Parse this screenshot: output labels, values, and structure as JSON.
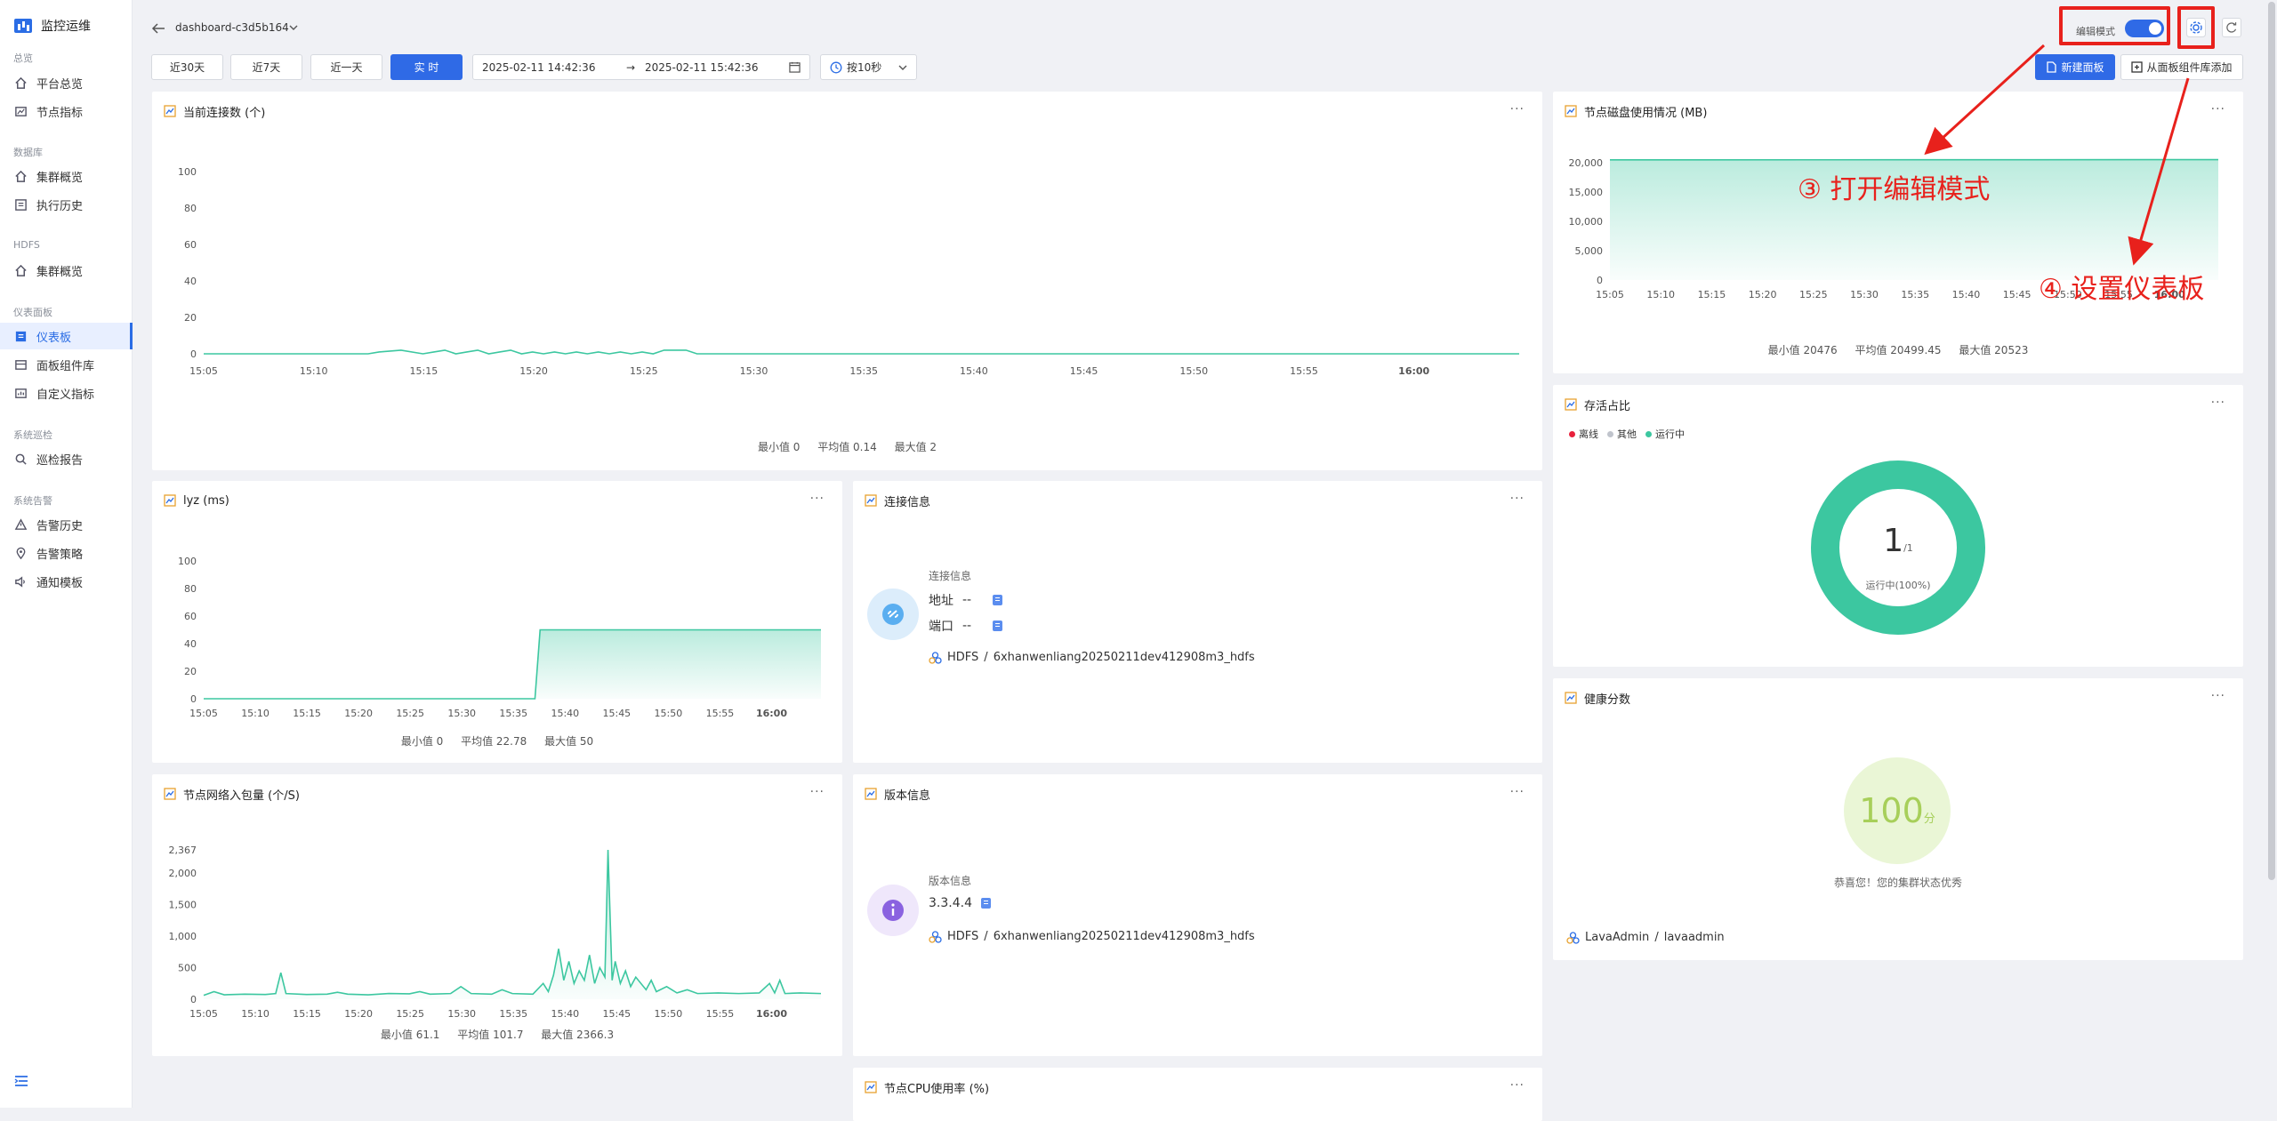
{
  "sidebar": {
    "brand": "监控运维",
    "sections": [
      {
        "title": "总览",
        "items": [
          {
            "label": "平台总览"
          },
          {
            "label": "节点指标"
          }
        ]
      },
      {
        "title": "数据库",
        "items": [
          {
            "label": "集群概览"
          },
          {
            "label": "执行历史"
          }
        ]
      },
      {
        "title": "HDFS",
        "items": [
          {
            "label": "集群概览"
          }
        ]
      },
      {
        "title": "仪表面板",
        "items": [
          {
            "label": "仪表板"
          },
          {
            "label": "面板组件库"
          },
          {
            "label": "自定义指标"
          }
        ]
      },
      {
        "title": "系统巡检",
        "items": [
          {
            "label": "巡检报告"
          }
        ]
      },
      {
        "title": "系统告警",
        "items": [
          {
            "label": "告警历史"
          },
          {
            "label": "告警策略"
          },
          {
            "label": "通知模板"
          }
        ]
      }
    ],
    "active": "仪表板"
  },
  "header": {
    "dashboard_name": "dashboard-c3d5b164",
    "quick_ranges": [
      "近30天",
      "近7天",
      "近一天",
      "实 时"
    ],
    "active_range": "实 时",
    "range_start": "2025-02-11 14:42:36",
    "range_arrow": "→",
    "range_end": "2025-02-11 15:42:36",
    "refresh": "按10秒",
    "edit_mode_label": "编辑模式",
    "edit_mode_on": true,
    "new_panel": "新建面板",
    "add_from_library": "从面板组件库添加"
  },
  "annotations": {
    "open_edit": "③ 打开编辑模式",
    "set_dashboard": "④ 设置仪表板"
  },
  "panels": {
    "connections": {
      "title": "当前连接数 (个)",
      "stats": {
        "min": "最小值 0",
        "avg": "平均值 0.14",
        "max": "最大值 2"
      }
    },
    "disk": {
      "title": "节点磁盘使用情况 (MB)",
      "stats": {
        "min": "最小值 20476",
        "avg": "平均值 20499.45",
        "max": "最大值 20523"
      }
    },
    "lyz": {
      "title": "lyz (ms)",
      "stats": {
        "min": "最小值 0",
        "avg": "平均值 22.78",
        "max": "最大值 50"
      }
    },
    "conn_info": {
      "title": "连接信息",
      "section_label": "连接信息",
      "address_label": "地址",
      "address_value": "--",
      "port_label": "端口",
      "port_value": "--",
      "crumb_root": "HDFS",
      "crumb_sep": "/",
      "crumb_leaf": "6xhanwenliang20250211dev412908m3_hdfs"
    },
    "alive": {
      "title": "存活占比",
      "legend": [
        {
          "label": "离线",
          "color": "#e8213c"
        },
        {
          "label": "其他",
          "color": "#c0c4cc"
        },
        {
          "label": "运行中",
          "color": "#3cc7a0"
        }
      ],
      "center_value": "1",
      "center_total": "/1",
      "center_caption": "运行中(100%)",
      "running_fraction": 1.0
    },
    "net": {
      "title": "节点网络入包量 (个/S)",
      "stats": {
        "min": "最小值 61.1",
        "avg": "平均值 101.7",
        "max": "最大值 2366.3"
      }
    },
    "version": {
      "title": "版本信息",
      "section_label": "版本信息",
      "version_value": "3.3.4.4",
      "crumb_root": "HDFS",
      "crumb_sep": "/",
      "crumb_leaf": "6xhanwenliang20250211dev412908m3_hdfs"
    },
    "health": {
      "title": "健康分数",
      "score": "100",
      "unit": "分",
      "caption": "恭喜您！您的集群状态优秀",
      "user_root": "LavaAdmin",
      "user_sep": "/",
      "user_leaf": "lavaadmin"
    },
    "cpu": {
      "title": "节点CPU使用率 (%)"
    }
  },
  "colors": {
    "accent": "#2f6ae6",
    "series": "#3cc7a0",
    "annotation": "#e8211c"
  },
  "chart_data": [
    {
      "type": "line",
      "title": "当前连接数 (个)",
      "x": [
        "15:05",
        "15:10",
        "15:15",
        "15:20",
        "15:25",
        "15:30",
        "15:35",
        "15:40",
        "15:45",
        "15:50",
        "15:55",
        "16:00"
      ],
      "x_bold": "16:00",
      "ylim": [
        0,
        100
      ],
      "yticks": [
        0,
        20,
        40,
        60,
        80,
        100
      ],
      "xrange": [
        0,
        60
      ],
      "points": [
        [
          0,
          0
        ],
        [
          7.5,
          0
        ],
        [
          8,
          1
        ],
        [
          9,
          2
        ],
        [
          10,
          0
        ],
        [
          10.5,
          1
        ],
        [
          11,
          2
        ],
        [
          11.5,
          0
        ],
        [
          12,
          1
        ],
        [
          12.5,
          2
        ],
        [
          13,
          0
        ],
        [
          13.5,
          1
        ],
        [
          14,
          2
        ],
        [
          14.5,
          0
        ],
        [
          15,
          1
        ],
        [
          15.5,
          0
        ],
        [
          16,
          1
        ],
        [
          16.5,
          0
        ],
        [
          17,
          1
        ],
        [
          17.5,
          0
        ],
        [
          18,
          1
        ],
        [
          18.5,
          0
        ],
        [
          19,
          1
        ],
        [
          19.5,
          0
        ],
        [
          20,
          1
        ],
        [
          20.5,
          0
        ],
        [
          21,
          2
        ],
        [
          22,
          2
        ],
        [
          22.5,
          0
        ],
        [
          60,
          0
        ]
      ]
    },
    {
      "type": "area",
      "title": "节点磁盘使用情况 (MB)",
      "x": [
        "15:05",
        "15:10",
        "15:15",
        "15:20",
        "15:25",
        "15:30",
        "15:35",
        "15:40",
        "15:45",
        "15:50",
        "15:55",
        "16:00"
      ],
      "x_bold": "16:00",
      "ylim": [
        0,
        20000
      ],
      "yticks": [
        0,
        5000,
        10000,
        15000,
        20000
      ],
      "ytick_labels": [
        "0",
        "5,000",
        "10,000",
        "15,000",
        "20,000"
      ],
      "xrange": [
        0,
        60
      ],
      "points": [
        [
          0,
          20476
        ],
        [
          30,
          20499
        ],
        [
          60,
          20523
        ]
      ]
    },
    {
      "type": "area",
      "title": "lyz (ms)",
      "x": [
        "15:05",
        "15:10",
        "15:15",
        "15:20",
        "15:25",
        "15:30",
        "15:35",
        "15:40",
        "15:45",
        "15:50",
        "15:55",
        "16:00"
      ],
      "x_bold": "16:00",
      "ylim": [
        0,
        100
      ],
      "yticks": [
        0,
        20,
        40,
        60,
        80,
        100
      ],
      "xrange": [
        0,
        60
      ],
      "points": [
        [
          0,
          0
        ],
        [
          32.2,
          0
        ],
        [
          32.7,
          50
        ],
        [
          60,
          50
        ]
      ]
    },
    {
      "type": "area",
      "title": "节点网络入包量 (个/S)",
      "x": [
        "15:05",
        "15:10",
        "15:15",
        "15:20",
        "15:25",
        "15:30",
        "15:35",
        "15:40",
        "15:45",
        "15:50",
        "15:55",
        "16:00"
      ],
      "x_bold": "16:00",
      "ylim": [
        0,
        2367
      ],
      "yticks": [
        0,
        500,
        1000,
        1500,
        2000,
        2367
      ],
      "ytick_labels": [
        "0",
        "500",
        "1,000",
        "1,500",
        "2,000",
        "2,367"
      ],
      "xrange": [
        0,
        60
      ],
      "points": [
        [
          0,
          61
        ],
        [
          1,
          120
        ],
        [
          2,
          70
        ],
        [
          4,
          80
        ],
        [
          6,
          75
        ],
        [
          7,
          90
        ],
        [
          7.5,
          420
        ],
        [
          8,
          90
        ],
        [
          10,
          75
        ],
        [
          12,
          80
        ],
        [
          13,
          110
        ],
        [
          14,
          80
        ],
        [
          16,
          70
        ],
        [
          18,
          90
        ],
        [
          20,
          85
        ],
        [
          21,
          120
        ],
        [
          22,
          80
        ],
        [
          24,
          90
        ],
        [
          25,
          200
        ],
        [
          26,
          90
        ],
        [
          28,
          80
        ],
        [
          29,
          150
        ],
        [
          30,
          90
        ],
        [
          32,
          80
        ],
        [
          33,
          250
        ],
        [
          33.5,
          120
        ],
        [
          34,
          380
        ],
        [
          34.5,
          800
        ],
        [
          35,
          300
        ],
        [
          35.5,
          600
        ],
        [
          36,
          250
        ],
        [
          36.5,
          450
        ],
        [
          37,
          300
        ],
        [
          37.5,
          700
        ],
        [
          38,
          250
        ],
        [
          38.5,
          500
        ],
        [
          39,
          350
        ],
        [
          39.3,
          2366
        ],
        [
          39.7,
          300
        ],
        [
          40,
          600
        ],
        [
          40.5,
          250
        ],
        [
          41,
          450
        ],
        [
          41.5,
          200
        ],
        [
          42,
          350
        ],
        [
          43,
          150
        ],
        [
          43.5,
          300
        ],
        [
          44,
          120
        ],
        [
          45,
          200
        ],
        [
          46,
          100
        ],
        [
          47,
          150
        ],
        [
          48,
          90
        ],
        [
          50,
          100
        ],
        [
          52,
          90
        ],
        [
          54,
          100
        ],
        [
          55,
          250
        ],
        [
          55.5,
          100
        ],
        [
          56,
          300
        ],
        [
          56.5,
          90
        ],
        [
          58,
          100
        ],
        [
          60,
          90
        ]
      ]
    }
  ]
}
